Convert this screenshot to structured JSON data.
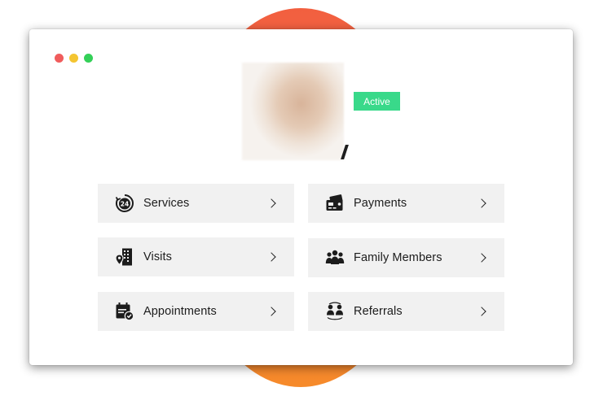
{
  "profile": {
    "status": "Active"
  },
  "menu": [
    {
      "label": "Services",
      "icon": "clock-24-icon"
    },
    {
      "label": "Payments",
      "icon": "wallet-card-icon"
    },
    {
      "label": "Visits",
      "icon": "building-location-icon"
    },
    {
      "label": "Family Members",
      "icon": "family-icon"
    },
    {
      "label": "Appointments",
      "icon": "calendar-check-icon"
    },
    {
      "label": "Referrals",
      "icon": "referral-users-icon"
    }
  ],
  "colors": {
    "status_badge": "#39d98a",
    "card_background": "#f1f1f1",
    "accent_circle": "#f3704a"
  }
}
